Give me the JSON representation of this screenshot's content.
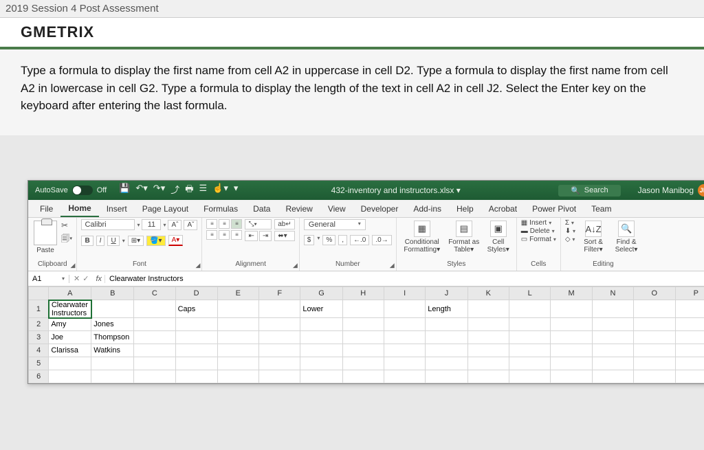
{
  "page_header": "2019 Session 4 Post Assessment",
  "logo_text": "GMETRIX",
  "instruction": "Type a formula to display the first name from cell A2 in uppercase in cell D2. Type a formula to display the first name from cell A2 in lowercase in cell G2. Type a formula to display the length of the text in cell A2 in cell J2. Select the Enter key on the keyboard after entering the last formula.",
  "titlebar": {
    "autosave_label": "AutoSave",
    "autosave_state": "Off",
    "doc_name": "432-inventory and instructors.xlsx",
    "search_placeholder": "Search",
    "user_name": "Jason Manibog",
    "user_initials": "JM"
  },
  "tabs": [
    "File",
    "Home",
    "Insert",
    "Page Layout",
    "Formulas",
    "Data",
    "Review",
    "View",
    "Developer",
    "Add-ins",
    "Help",
    "Acrobat",
    "Power Pivot",
    "Team"
  ],
  "active_tab": "Home",
  "ribbon": {
    "clipboard": {
      "label": "Clipboard",
      "paste": "Paste"
    },
    "font": {
      "label": "Font",
      "name": "Calibri",
      "size": "11",
      "inc": "Aˆ",
      "dec": "Aˇ",
      "bold": "B",
      "italic": "I",
      "underline": "U"
    },
    "alignment": {
      "label": "Alignment",
      "wrap": "↵"
    },
    "number": {
      "label": "Number",
      "format": "General",
      "currency": "$",
      "percent": "%",
      "comma": ",",
      "inc": "←.0",
      "dec": ".0→"
    },
    "styles": {
      "label": "Styles",
      "cf": "Conditional Formatting",
      "fat": "Format as Table",
      "cs": "Cell Styles"
    },
    "cells": {
      "label": "Cells",
      "insert": "Insert",
      "delete": "Delete",
      "format": "Format"
    },
    "editing": {
      "label": "Editing",
      "sum": "Σ",
      "sort": "Sort & Filter",
      "find": "Find & Select"
    }
  },
  "namebox": "A1",
  "formula_value": "Clearwater Instructors",
  "columns": [
    "A",
    "B",
    "C",
    "D",
    "E",
    "F",
    "G",
    "H",
    "I",
    "J",
    "K",
    "L",
    "M",
    "N",
    "O",
    "P"
  ],
  "rows": [
    {
      "n": "1",
      "cells": [
        "Clearwater Instructors",
        "",
        "",
        "Caps",
        "",
        "",
        "Lower",
        "",
        "",
        "Length",
        "",
        "",
        "",
        "",
        "",
        ""
      ]
    },
    {
      "n": "2",
      "cells": [
        "Amy",
        "Jones",
        "",
        "",
        "",
        "",
        "",
        "",
        "",
        "",
        "",
        "",
        "",
        "",
        "",
        ""
      ]
    },
    {
      "n": "3",
      "cells": [
        "Joe",
        "Thompson",
        "",
        "",
        "",
        "",
        "",
        "",
        "",
        "",
        "",
        "",
        "",
        "",
        "",
        ""
      ]
    },
    {
      "n": "4",
      "cells": [
        "Clarissa",
        "Watkins",
        "",
        "",
        "",
        "",
        "",
        "",
        "",
        "",
        "",
        "",
        "",
        "",
        "",
        ""
      ]
    },
    {
      "n": "5",
      "cells": [
        "",
        "",
        "",
        "",
        "",
        "",
        "",
        "",
        "",
        "",
        "",
        "",
        "",
        "",
        "",
        ""
      ]
    },
    {
      "n": "6",
      "cells": [
        "",
        "",
        "",
        "",
        "",
        "",
        "",
        "",
        "",
        "",
        "",
        "",
        "",
        "",
        "",
        ""
      ]
    }
  ]
}
